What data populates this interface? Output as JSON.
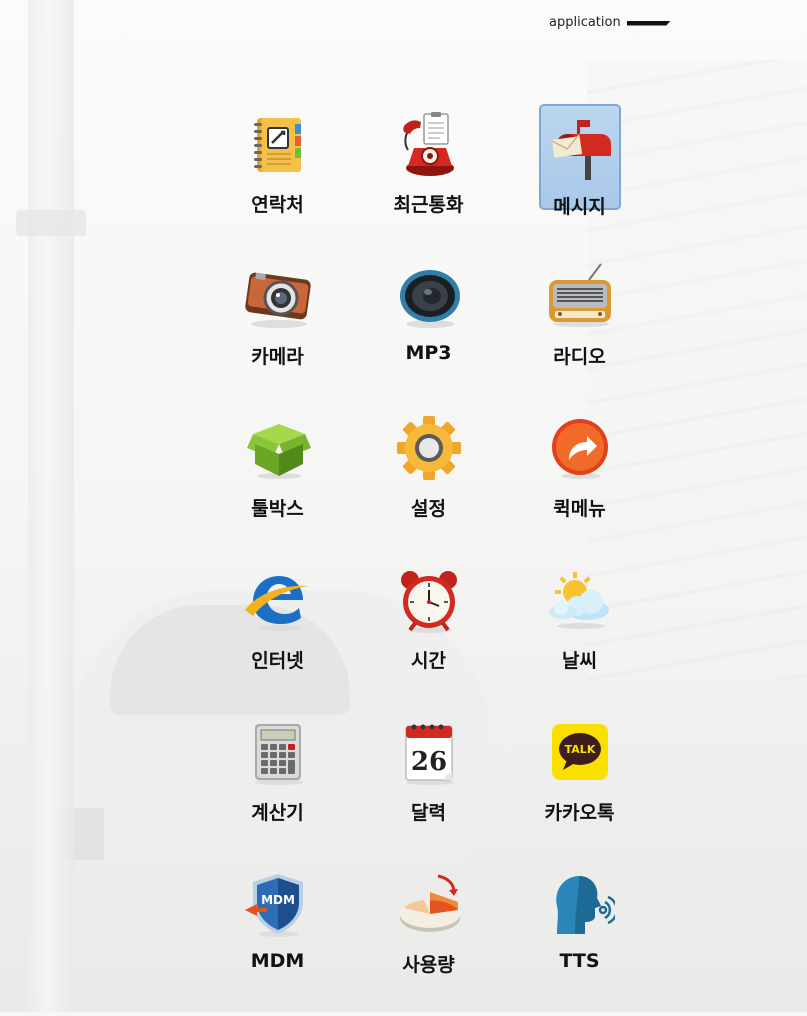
{
  "header": {
    "title": "application"
  },
  "apps": [
    {
      "label": "연락처",
      "icon": "contacts-book-icon",
      "selected": false
    },
    {
      "label": "최근통화",
      "icon": "red-telephone-icon",
      "selected": false
    },
    {
      "label": "메시지",
      "icon": "mailbox-icon",
      "selected": true
    },
    {
      "label": "카메라",
      "icon": "camera-icon",
      "selected": false
    },
    {
      "label": "MP3",
      "icon": "speaker-icon",
      "selected": false
    },
    {
      "label": "라디오",
      "icon": "radio-icon",
      "selected": false
    },
    {
      "label": "툴박스",
      "icon": "green-box-icon",
      "selected": false
    },
    {
      "label": "설정",
      "icon": "gear-icon",
      "selected": false
    },
    {
      "label": "퀵메뉴",
      "icon": "orange-arrow-icon",
      "selected": false
    },
    {
      "label": "인터넷",
      "icon": "internet-explorer-icon",
      "selected": false
    },
    {
      "label": "시간",
      "icon": "alarm-clock-icon",
      "selected": false
    },
    {
      "label": "날씨",
      "icon": "weather-sun-cloud-icon",
      "selected": false
    },
    {
      "label": "계산기",
      "icon": "calculator-icon",
      "selected": false
    },
    {
      "label": "달력",
      "icon": "calendar-icon",
      "selected": false,
      "calendar_day": "26"
    },
    {
      "label": "카카오톡",
      "icon": "kakaotalk-icon",
      "selected": false,
      "badge_text": "TALK"
    },
    {
      "label": "MDM",
      "icon": "mdm-shield-icon",
      "selected": false,
      "badge_text": "MDM"
    },
    {
      "label": "사용량",
      "icon": "usage-pie-chart-icon",
      "selected": false
    },
    {
      "label": "TTS",
      "icon": "tts-head-icon",
      "selected": false
    }
  ],
  "colors": {
    "selected_bg": "#a9c8e8",
    "selected_border": "#7ea8d6",
    "label_text": "#111111"
  }
}
